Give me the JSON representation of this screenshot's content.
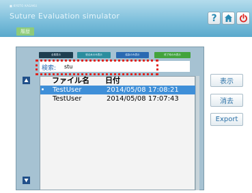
{
  "header": {
    "maker": "■ KYOTO KAGAKU",
    "title": "Suture Evaluation simulator",
    "breadcrumb": "履歴",
    "colors": {
      "gradient_top": "#b4dcec",
      "gradient_bottom": "#5aa9cc"
    }
  },
  "toolbar": {
    "help_glyph": "?",
    "help_icon": "question-mark-icon",
    "home_icon": "home-icon",
    "power_icon": "power-icon",
    "power_color": "#e0231d"
  },
  "filter_tabs": [
    {
      "label": "全員表示",
      "color": "#1e3e50"
    },
    {
      "label": "縫合糸のみ表示",
      "color": "#2b8d9e"
    },
    {
      "label": "結紮のみ表示",
      "color": "#2a6ab2"
    },
    {
      "label": "終了時のみ表示",
      "color": "#43a33c"
    }
  ],
  "search": {
    "label": "検索:",
    "value": "stu"
  },
  "file_list": {
    "columns": [
      "ファイル名",
      "日付"
    ],
    "rows": [
      {
        "name": "TestUser",
        "date": "2014/05/08 17:08:21",
        "selected": true
      },
      {
        "name": "TestUser",
        "date": "2014/05/08 17:07:43",
        "selected": false
      }
    ]
  },
  "actions": {
    "show_label": "表示",
    "delete_label": "消去",
    "export_label": "Export"
  },
  "nav": {
    "up_icon": "triangle-up-icon",
    "down_icon": "triangle-down-icon"
  }
}
